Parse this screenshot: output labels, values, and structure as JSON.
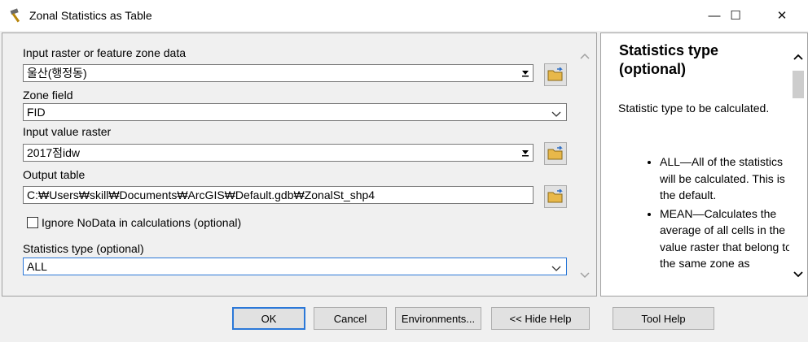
{
  "window": {
    "title": "Zonal Statistics as Table",
    "icon": "hammer-icon",
    "minimize_glyph": "—",
    "maximize_glyph": "☐",
    "close_glyph": "✕"
  },
  "params": {
    "input_zone": {
      "label": "Input raster or feature zone data",
      "value": "울산(행정동)"
    },
    "zone_field": {
      "label": "Zone field",
      "value": "FID"
    },
    "input_value_raster": {
      "label": "Input value raster",
      "value": "2017점idw"
    },
    "output_table": {
      "label": "Output table",
      "value": "C:₩Users₩skill₩Documents₩ArcGIS₩Default.gdb₩ZonalSt_shp4"
    },
    "ignore_nodata": {
      "label": "Ignore NoData in calculations (optional)",
      "checked": false
    },
    "statistics_type": {
      "label": "Statistics type (optional)",
      "value": "ALL"
    }
  },
  "help": {
    "title": "Statistics type (optional)",
    "description": "Statistic type to be calculated.",
    "items": [
      "ALL—All of the statistics will be calculated. This is the default.",
      "MEAN—Calculates the average of all cells in the value raster that belong to the same zone as"
    ]
  },
  "buttons": {
    "ok": "OK",
    "cancel": "Cancel",
    "environments": "Environments...",
    "hide_help": "<< Hide Help",
    "tool_help": "Tool Help"
  },
  "colors": {
    "accent": "#2b78d8",
    "folder": "#e8b84a"
  }
}
